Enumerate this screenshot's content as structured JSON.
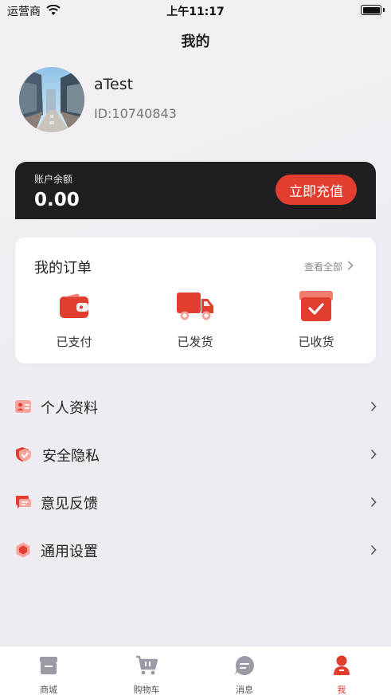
{
  "status_bar": {
    "carrier": "运营商",
    "time": "上午11:17"
  },
  "page": {
    "title": "我的"
  },
  "profile": {
    "username": "aTest",
    "user_id": "ID:10740843"
  },
  "balance": {
    "label": "账户余额",
    "value": "0.00",
    "recharge_label": "立即充值"
  },
  "orders": {
    "title": "我的订单",
    "view_all": "查看全部",
    "items": [
      {
        "label": "已支付",
        "icon": "wallet-icon"
      },
      {
        "label": "已发货",
        "icon": "truck-icon"
      },
      {
        "label": "已收货",
        "icon": "received-box-icon"
      }
    ]
  },
  "menu": {
    "items": [
      {
        "label": "个人资料",
        "icon": "profile-card-icon"
      },
      {
        "label": "安全隐私",
        "icon": "shield-icon"
      },
      {
        "label": "意见反馈",
        "icon": "feedback-icon"
      },
      {
        "label": "通用设置",
        "icon": "settings-hexagon-icon"
      }
    ]
  },
  "tabs": [
    {
      "label": "商城",
      "icon": "store-icon"
    },
    {
      "label": "购物车",
      "icon": "cart-icon"
    },
    {
      "label": "消息",
      "icon": "message-icon"
    },
    {
      "label": "我",
      "icon": "person-icon",
      "active": true
    }
  ],
  "colors": {
    "accent": "#e23e2f",
    "dark_card": "#1f1f21",
    "tab_inactive": "#9a9ba5"
  }
}
